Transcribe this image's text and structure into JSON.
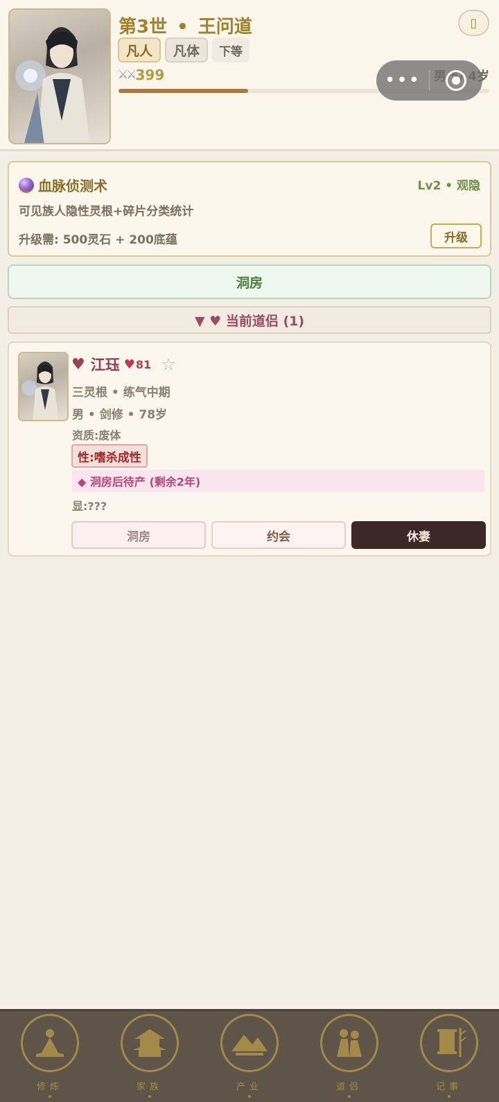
{
  "header": {
    "generation": "第3世",
    "separator": "•",
    "name": "王问道",
    "tags": [
      "凡人",
      "凡体",
      "下等"
    ],
    "power_icon": "crossed-swords-icon",
    "power": "399",
    "age_info": "男 5/ 4岁",
    "exp_progress": 0.35,
    "corner_icon": "scroll-icon"
  },
  "capsule": {
    "more": "•••",
    "close_icon": "target-circle-icon"
  },
  "skill": {
    "icon": "crystal-orb-icon",
    "name": "血脉侦测术",
    "level": "Lv2 • 观隐",
    "description": "可见族人隐性灵根+碎片分类统计",
    "cost": "升级需: 500灵石 + 200底蕴",
    "upgrade_label": "升级"
  },
  "room_bar": {
    "label": "洞房"
  },
  "section": {
    "title": "▼ ♥ 当前道侣 (1)"
  },
  "partner": {
    "heart": "♥",
    "name": "江珏",
    "affection_icon": "♥",
    "affection": "81",
    "star": "☆",
    "line1": "三灵根 • 练气中期",
    "line2": "男 • 剑修 • 78岁",
    "aptitude": "资质:废体",
    "trait": "性:嗜杀成性",
    "pregnancy": "◆ 洞房后待产 (剩余2年)",
    "hidden": "显:???",
    "actions": [
      "洞房",
      "约会",
      "休妻"
    ]
  },
  "nav": {
    "items": [
      {
        "label": "修炼",
        "icon": "meditation-icon"
      },
      {
        "label": "家族",
        "icon": "pavilion-icon"
      },
      {
        "label": "产业",
        "icon": "mountain-village-icon"
      },
      {
        "label": "道侣",
        "icon": "couple-icon"
      },
      {
        "label": "记事",
        "icon": "scroll-bamboo-icon"
      }
    ]
  },
  "colors": {
    "gold": "#a1802e",
    "green": "#4f7d3f",
    "rose": "#9e4a66",
    "nav_bg": "#5e5448"
  }
}
